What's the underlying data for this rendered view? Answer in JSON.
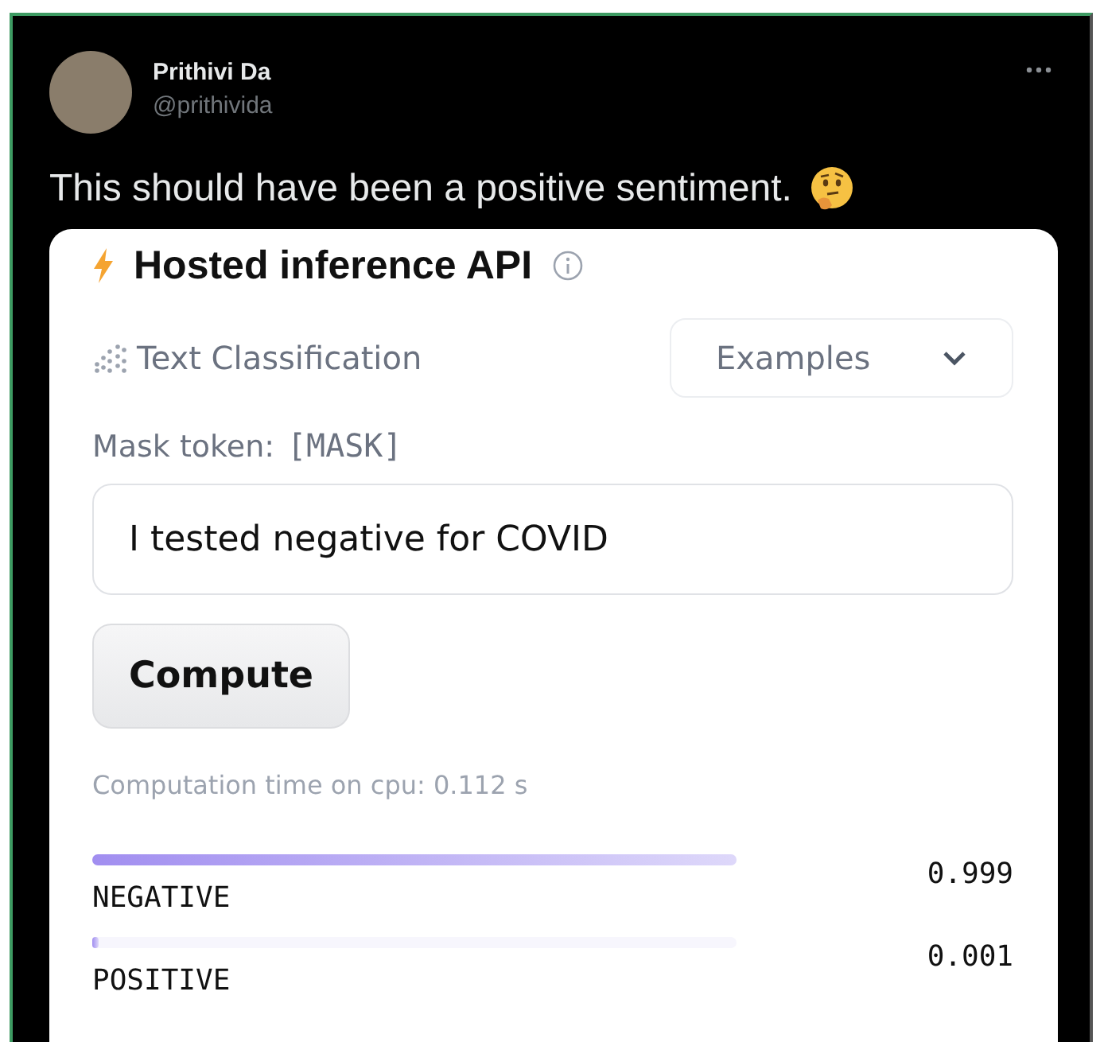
{
  "tweet": {
    "author_name": "Prithivi Da",
    "handle": "@prithivida",
    "text": "This should have been a positive sentiment."
  },
  "widget": {
    "title": "Hosted inference API",
    "task": "Text Classification",
    "examples_label": "Examples",
    "mask_label": "Mask token:",
    "mask_token": "[MASK]",
    "input_value": "I tested negative for COVID",
    "compute_button": "Compute",
    "computation_time": "Computation time on cpu: 0.112 s",
    "results": [
      {
        "label": "NEGATIVE",
        "level": 0.999,
        "score": "0.999"
      },
      {
        "label": "POSITIVE",
        "level": 0.001,
        "score": "0.001"
      }
    ]
  }
}
